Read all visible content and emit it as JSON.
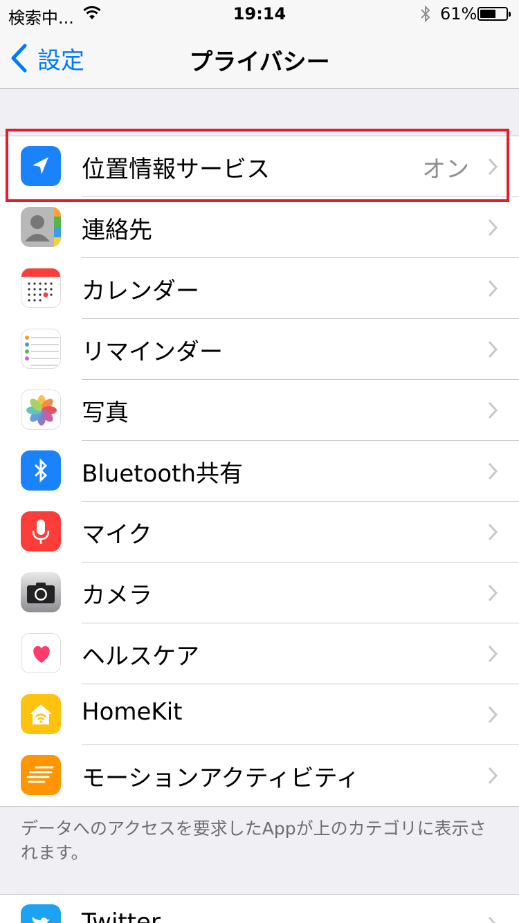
{
  "status_bar": {
    "carrier": "検索中...",
    "time": "19:14",
    "battery_percent": "61%",
    "battery_level": 0.61
  },
  "nav": {
    "back_label": "設定",
    "title": "プライバシー"
  },
  "privacy_items": [
    {
      "label": "位置情報サービス",
      "detail": "オン",
      "icon": "location-arrow-icon"
    },
    {
      "label": "連絡先",
      "detail": "",
      "icon": "contacts-icon"
    },
    {
      "label": "カレンダー",
      "detail": "",
      "icon": "calendar-icon"
    },
    {
      "label": "リマインダー",
      "detail": "",
      "icon": "reminders-icon"
    },
    {
      "label": "写真",
      "detail": "",
      "icon": "photos-icon"
    },
    {
      "label": "Bluetooth共有",
      "detail": "",
      "icon": "bluetooth-icon"
    },
    {
      "label": "マイク",
      "detail": "",
      "icon": "microphone-icon"
    },
    {
      "label": "カメラ",
      "detail": "",
      "icon": "camera-icon"
    },
    {
      "label": "ヘルスケア",
      "detail": "",
      "icon": "health-heart-icon"
    },
    {
      "label": "HomeKit",
      "detail": "",
      "icon": "homekit-icon"
    },
    {
      "label": "モーションアクティビティ",
      "detail": "",
      "icon": "motion-activity-icon"
    }
  ],
  "footer_note": "データへのアクセスを要求したAppが上のカテゴリに表示されます。",
  "social_items": [
    {
      "label": "Twitter",
      "icon": "twitter-icon"
    }
  ],
  "colors": {
    "accent": "#007aff",
    "highlight": "#e81b2a",
    "background": "#efeff4"
  }
}
